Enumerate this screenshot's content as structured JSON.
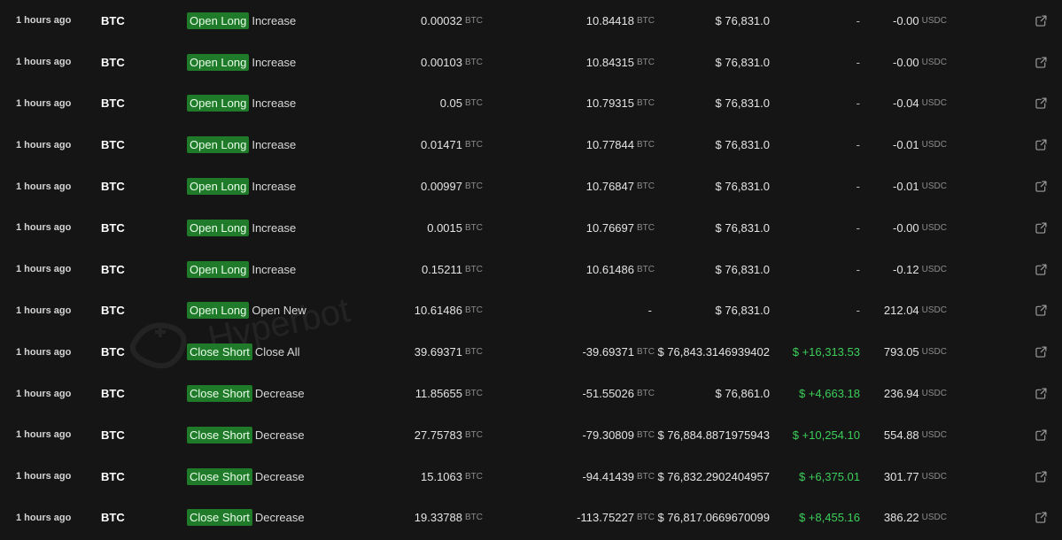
{
  "rows": [
    {
      "time": "1 hours ago",
      "asset": "BTC",
      "badge": "Open Long",
      "action": "Increase",
      "size": "0.00032",
      "size_unit": "BTC",
      "position": "10.84418",
      "position_unit": "BTC",
      "price": "$ 76,831.0",
      "pnl": "-",
      "pnl_status": "none",
      "fee": "-0.00",
      "fee_unit": "USDC"
    },
    {
      "time": "1 hours ago",
      "asset": "BTC",
      "badge": "Open Long",
      "action": "Increase",
      "size": "0.00103",
      "size_unit": "BTC",
      "position": "10.84315",
      "position_unit": "BTC",
      "price": "$ 76,831.0",
      "pnl": "-",
      "pnl_status": "none",
      "fee": "-0.00",
      "fee_unit": "USDC"
    },
    {
      "time": "1 hours ago",
      "asset": "BTC",
      "badge": "Open Long",
      "action": "Increase",
      "size": "0.05",
      "size_unit": "BTC",
      "position": "10.79315",
      "position_unit": "BTC",
      "price": "$ 76,831.0",
      "pnl": "-",
      "pnl_status": "none",
      "fee": "-0.04",
      "fee_unit": "USDC"
    },
    {
      "time": "1 hours ago",
      "asset": "BTC",
      "badge": "Open Long",
      "action": "Increase",
      "size": "0.01471",
      "size_unit": "BTC",
      "position": "10.77844",
      "position_unit": "BTC",
      "price": "$ 76,831.0",
      "pnl": "-",
      "pnl_status": "none",
      "fee": "-0.01",
      "fee_unit": "USDC"
    },
    {
      "time": "1 hours ago",
      "asset": "BTC",
      "badge": "Open Long",
      "action": "Increase",
      "size": "0.00997",
      "size_unit": "BTC",
      "position": "10.76847",
      "position_unit": "BTC",
      "price": "$ 76,831.0",
      "pnl": "-",
      "pnl_status": "none",
      "fee": "-0.01",
      "fee_unit": "USDC"
    },
    {
      "time": "1 hours ago",
      "asset": "BTC",
      "badge": "Open Long",
      "action": "Increase",
      "size": "0.0015",
      "size_unit": "BTC",
      "position": "10.76697",
      "position_unit": "BTC",
      "price": "$ 76,831.0",
      "pnl": "-",
      "pnl_status": "none",
      "fee": "-0.00",
      "fee_unit": "USDC"
    },
    {
      "time": "1 hours ago",
      "asset": "BTC",
      "badge": "Open Long",
      "action": "Increase",
      "size": "0.15211",
      "size_unit": "BTC",
      "position": "10.61486",
      "position_unit": "BTC",
      "price": "$ 76,831.0",
      "pnl": "-",
      "pnl_status": "none",
      "fee": "-0.12",
      "fee_unit": "USDC"
    },
    {
      "time": "1 hours ago",
      "asset": "BTC",
      "badge": "Open Long",
      "action": "Open New",
      "size": "10.61486",
      "size_unit": "BTC",
      "position": "-",
      "position_unit": "",
      "price": "$ 76,831.0",
      "pnl": "-",
      "pnl_status": "none",
      "fee": "212.04",
      "fee_unit": "USDC"
    },
    {
      "time": "1 hours ago",
      "asset": "BTC",
      "badge": "Close Short",
      "action": "Close All",
      "size": "39.69371",
      "size_unit": "BTC",
      "position": "-39.69371",
      "position_unit": "BTC",
      "price": "$ 76,843.3146939402",
      "pnl": "$ +16,313.53",
      "pnl_status": "gain",
      "fee": "793.05",
      "fee_unit": "USDC"
    },
    {
      "time": "1 hours ago",
      "asset": "BTC",
      "badge": "Close Short",
      "action": "Decrease",
      "size": "11.85655",
      "size_unit": "BTC",
      "position": "-51.55026",
      "position_unit": "BTC",
      "price": "$ 76,861.0",
      "pnl": "$ +4,663.18",
      "pnl_status": "gain",
      "fee": "236.94",
      "fee_unit": "USDC"
    },
    {
      "time": "1 hours ago",
      "asset": "BTC",
      "badge": "Close Short",
      "action": "Decrease",
      "size": "27.75783",
      "size_unit": "BTC",
      "position": "-79.30809",
      "position_unit": "BTC",
      "price": "$ 76,884.8871975943",
      "pnl": "$ +10,254.10",
      "pnl_status": "gain",
      "fee": "554.88",
      "fee_unit": "USDC"
    },
    {
      "time": "1 hours ago",
      "asset": "BTC",
      "badge": "Close Short",
      "action": "Decrease",
      "size": "15.1063",
      "size_unit": "BTC",
      "position": "-94.41439",
      "position_unit": "BTC",
      "price": "$ 76,832.2902404957",
      "pnl": "$ +6,375.01",
      "pnl_status": "gain",
      "fee": "301.77",
      "fee_unit": "USDC"
    },
    {
      "time": "1 hours ago",
      "asset": "BTC",
      "badge": "Close Short",
      "action": "Decrease",
      "size": "19.33788",
      "size_unit": "BTC",
      "position": "-113.75227",
      "position_unit": "BTC",
      "price": "$ 76,817.0669670099",
      "pnl": "$ +8,455.16",
      "pnl_status": "gain",
      "fee": "386.22",
      "fee_unit": "USDC"
    }
  ],
  "colors": {
    "background": "#151515",
    "badge_green": "#1f7a2a",
    "gain_green": "#3ccf5a"
  },
  "icons": {
    "row_link": "external-link-icon"
  },
  "watermark": "Hyperbot"
}
